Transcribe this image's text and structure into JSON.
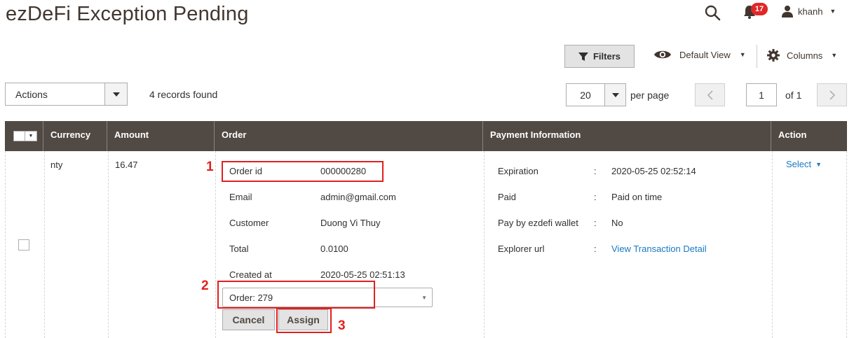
{
  "header": {
    "title": "ezDeFi Exception Pending",
    "notifications_count": "17",
    "username": "khanh"
  },
  "toolbar": {
    "filters_label": "Filters",
    "view_label": "Default View",
    "columns_label": "Columns"
  },
  "grid_controls": {
    "actions_label": "Actions",
    "records_found": "4 records found",
    "per_page_value": "20",
    "per_page_label": "per page",
    "current_page": "1",
    "total_pages_label": "of 1"
  },
  "columns": {
    "currency": "Currency",
    "amount": "Amount",
    "order": "Order",
    "payment_info": "Payment Information",
    "action": "Action"
  },
  "row": {
    "currency": "nty",
    "amount": "16.47",
    "order": {
      "order_id_label": "Order id",
      "order_id_value": "000000280",
      "email_label": "Email",
      "email_value": "admin@gmail.com",
      "customer_label": "Customer",
      "customer_value": "Duong Vi Thuy",
      "total_label": "Total",
      "total_value": "0.0100",
      "created_label": "Created at",
      "created_value": "2020-05-25 02:51:13",
      "assign_select_value": "Order: 279",
      "cancel_label": "Cancel",
      "assign_label": "Assign"
    },
    "payment": {
      "expiration_label": "Expiration",
      "expiration_value": "2020-05-25 02:52:14",
      "paid_label": "Paid",
      "paid_value": "Paid on time",
      "pay_by_label": "Pay by ezdefi wallet",
      "pay_by_value": "No",
      "explorer_label": "Explorer url",
      "explorer_value": "View Transaction Detail",
      "separator": ":"
    },
    "action_label": "Select"
  },
  "annotations": {
    "step1": "1",
    "step2": "2",
    "step3": "3",
    "color": "#e02020"
  },
  "colors": {
    "header_bg": "#514943",
    "link": "#1979c3",
    "badge": "#e22626"
  }
}
